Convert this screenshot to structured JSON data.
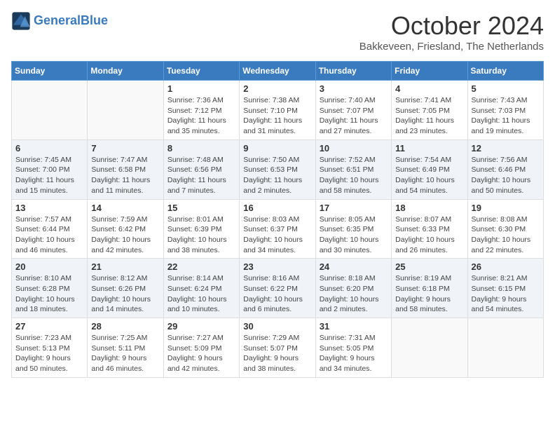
{
  "header": {
    "logo_line1": "General",
    "logo_line2": "Blue",
    "month_title": "October 2024",
    "location": "Bakkeveen, Friesland, The Netherlands"
  },
  "weekdays": [
    "Sunday",
    "Monday",
    "Tuesday",
    "Wednesday",
    "Thursday",
    "Friday",
    "Saturday"
  ],
  "weeks": [
    [
      {
        "day": "",
        "info": ""
      },
      {
        "day": "",
        "info": ""
      },
      {
        "day": "1",
        "info": "Sunrise: 7:36 AM\nSunset: 7:12 PM\nDaylight: 11 hours and 35 minutes."
      },
      {
        "day": "2",
        "info": "Sunrise: 7:38 AM\nSunset: 7:10 PM\nDaylight: 11 hours and 31 minutes."
      },
      {
        "day": "3",
        "info": "Sunrise: 7:40 AM\nSunset: 7:07 PM\nDaylight: 11 hours and 27 minutes."
      },
      {
        "day": "4",
        "info": "Sunrise: 7:41 AM\nSunset: 7:05 PM\nDaylight: 11 hours and 23 minutes."
      },
      {
        "day": "5",
        "info": "Sunrise: 7:43 AM\nSunset: 7:03 PM\nDaylight: 11 hours and 19 minutes."
      }
    ],
    [
      {
        "day": "6",
        "info": "Sunrise: 7:45 AM\nSunset: 7:00 PM\nDaylight: 11 hours and 15 minutes."
      },
      {
        "day": "7",
        "info": "Sunrise: 7:47 AM\nSunset: 6:58 PM\nDaylight: 11 hours and 11 minutes."
      },
      {
        "day": "8",
        "info": "Sunrise: 7:48 AM\nSunset: 6:56 PM\nDaylight: 11 hours and 7 minutes."
      },
      {
        "day": "9",
        "info": "Sunrise: 7:50 AM\nSunset: 6:53 PM\nDaylight: 11 hours and 2 minutes."
      },
      {
        "day": "10",
        "info": "Sunrise: 7:52 AM\nSunset: 6:51 PM\nDaylight: 10 hours and 58 minutes."
      },
      {
        "day": "11",
        "info": "Sunrise: 7:54 AM\nSunset: 6:49 PM\nDaylight: 10 hours and 54 minutes."
      },
      {
        "day": "12",
        "info": "Sunrise: 7:56 AM\nSunset: 6:46 PM\nDaylight: 10 hours and 50 minutes."
      }
    ],
    [
      {
        "day": "13",
        "info": "Sunrise: 7:57 AM\nSunset: 6:44 PM\nDaylight: 10 hours and 46 minutes."
      },
      {
        "day": "14",
        "info": "Sunrise: 7:59 AM\nSunset: 6:42 PM\nDaylight: 10 hours and 42 minutes."
      },
      {
        "day": "15",
        "info": "Sunrise: 8:01 AM\nSunset: 6:39 PM\nDaylight: 10 hours and 38 minutes."
      },
      {
        "day": "16",
        "info": "Sunrise: 8:03 AM\nSunset: 6:37 PM\nDaylight: 10 hours and 34 minutes."
      },
      {
        "day": "17",
        "info": "Sunrise: 8:05 AM\nSunset: 6:35 PM\nDaylight: 10 hours and 30 minutes."
      },
      {
        "day": "18",
        "info": "Sunrise: 8:07 AM\nSunset: 6:33 PM\nDaylight: 10 hours and 26 minutes."
      },
      {
        "day": "19",
        "info": "Sunrise: 8:08 AM\nSunset: 6:30 PM\nDaylight: 10 hours and 22 minutes."
      }
    ],
    [
      {
        "day": "20",
        "info": "Sunrise: 8:10 AM\nSunset: 6:28 PM\nDaylight: 10 hours and 18 minutes."
      },
      {
        "day": "21",
        "info": "Sunrise: 8:12 AM\nSunset: 6:26 PM\nDaylight: 10 hours and 14 minutes."
      },
      {
        "day": "22",
        "info": "Sunrise: 8:14 AM\nSunset: 6:24 PM\nDaylight: 10 hours and 10 minutes."
      },
      {
        "day": "23",
        "info": "Sunrise: 8:16 AM\nSunset: 6:22 PM\nDaylight: 10 hours and 6 minutes."
      },
      {
        "day": "24",
        "info": "Sunrise: 8:18 AM\nSunset: 6:20 PM\nDaylight: 10 hours and 2 minutes."
      },
      {
        "day": "25",
        "info": "Sunrise: 8:19 AM\nSunset: 6:18 PM\nDaylight: 9 hours and 58 minutes."
      },
      {
        "day": "26",
        "info": "Sunrise: 8:21 AM\nSunset: 6:15 PM\nDaylight: 9 hours and 54 minutes."
      }
    ],
    [
      {
        "day": "27",
        "info": "Sunrise: 7:23 AM\nSunset: 5:13 PM\nDaylight: 9 hours and 50 minutes."
      },
      {
        "day": "28",
        "info": "Sunrise: 7:25 AM\nSunset: 5:11 PM\nDaylight: 9 hours and 46 minutes."
      },
      {
        "day": "29",
        "info": "Sunrise: 7:27 AM\nSunset: 5:09 PM\nDaylight: 9 hours and 42 minutes."
      },
      {
        "day": "30",
        "info": "Sunrise: 7:29 AM\nSunset: 5:07 PM\nDaylight: 9 hours and 38 minutes."
      },
      {
        "day": "31",
        "info": "Sunrise: 7:31 AM\nSunset: 5:05 PM\nDaylight: 9 hours and 34 minutes."
      },
      {
        "day": "",
        "info": ""
      },
      {
        "day": "",
        "info": ""
      }
    ]
  ]
}
